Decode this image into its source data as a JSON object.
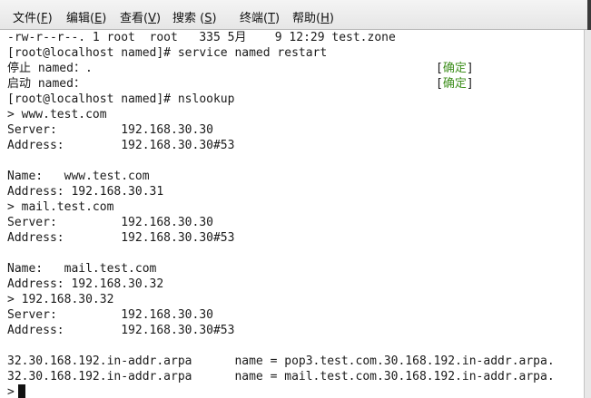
{
  "menu": {
    "items": [
      {
        "label": "文件(",
        "acc": "F",
        "close": ")"
      },
      {
        "label": "编辑(",
        "acc": "E",
        "close": ")"
      },
      {
        "label": "查看(",
        "acc": "V",
        "close": ")"
      },
      {
        "label": "搜索 (",
        "acc": "S",
        "close": ")"
      },
      {
        "label": "终端(",
        "acc": "T",
        "close": ")"
      },
      {
        "label": "帮助(",
        "acc": "H",
        "close": ")"
      }
    ]
  },
  "terminal": {
    "lines": [
      "-rw-r--r--. 1 root  root   335 5月    9 12:29 test.zone",
      "[root@localhost named]# service named restart",
      "停止 named：.",
      "启动 named：",
      "[root@localhost named]# nslookup",
      "> www.test.com",
      "Server:         192.168.30.30",
      "Address:        192.168.30.30#53",
      "",
      "Name:   www.test.com",
      "Address: 192.168.30.31",
      "> mail.test.com",
      "Server:         192.168.30.30",
      "Address:        192.168.30.30#53",
      "",
      "Name:   mail.test.com",
      "Address: 192.168.30.32",
      "> 192.168.30.32",
      "Server:         192.168.30.30",
      "Address:        192.168.30.30#53",
      "",
      "32.30.168.192.in-addr.arpa      name = pop3.test.com.30.168.192.in-addr.arpa.",
      "32.30.168.192.in-addr.arpa      name = mail.test.com.30.168.192.in-addr.arpa.",
      ">"
    ],
    "status": {
      "bracket_open": "[",
      "ok_text": "确定",
      "bracket_close": "]"
    }
  }
}
